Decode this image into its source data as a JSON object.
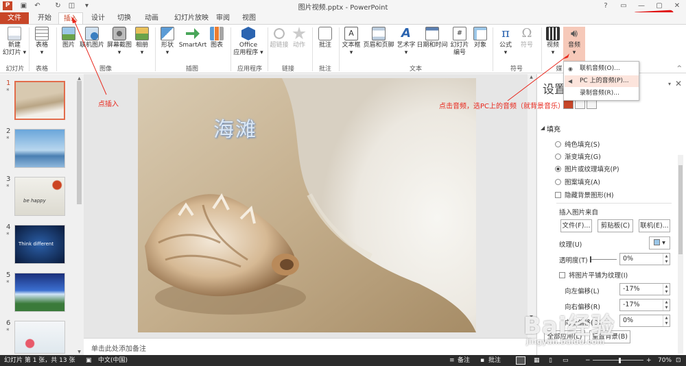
{
  "window": {
    "title": "图片视频.pptx - PowerPoint",
    "app_logo": "P",
    "controls": [
      "?",
      "▭",
      "—",
      "▢",
      "✕"
    ]
  },
  "qat": [
    "save-icon",
    "undo-icon",
    "redo-icon",
    "slideshow-icon",
    "customize-icon"
  ],
  "tabs": [
    {
      "label": "文件"
    },
    {
      "label": "开始"
    },
    {
      "label": "插入"
    },
    {
      "label": "设计"
    },
    {
      "label": "切换"
    },
    {
      "label": "动画"
    },
    {
      "label": "幻灯片放映"
    },
    {
      "label": "审阅"
    },
    {
      "label": "视图"
    }
  ],
  "ribbon": {
    "buttons": [
      {
        "label": "新建\n幻灯片 ▾"
      },
      {
        "label": "表格\n▾"
      },
      {
        "label": "图片"
      },
      {
        "label": "联机图片"
      },
      {
        "label": "屏幕截图\n▾"
      },
      {
        "label": "相册\n▾"
      },
      {
        "label": "形状\n▾"
      },
      {
        "label": "SmartArt"
      },
      {
        "label": "图表"
      },
      {
        "label": "Office\n应用程序 ▾"
      },
      {
        "label": "超链接"
      },
      {
        "label": "动作"
      },
      {
        "label": "批注"
      },
      {
        "label": "文本框\n▾"
      },
      {
        "label": "页眉和页脚"
      },
      {
        "label": "艺术字\n▾"
      },
      {
        "label": "日期和时间"
      },
      {
        "label": "幻灯片\n编号"
      },
      {
        "label": "对象"
      },
      {
        "label": "公式\n▾"
      },
      {
        "label": "符号"
      },
      {
        "label": "视频\n▾"
      },
      {
        "label": "音频\n▾"
      }
    ],
    "groups": [
      {
        "label": "幻灯片"
      },
      {
        "label": "表格"
      },
      {
        "label": "图像"
      },
      {
        "label": "插图"
      },
      {
        "label": "应用程序"
      },
      {
        "label": "链接"
      },
      {
        "label": "批注"
      },
      {
        "label": "文本"
      },
      {
        "label": "符号"
      },
      {
        "label": "媒"
      }
    ],
    "collapse_glyph": "^"
  },
  "audio_menu": {
    "items": [
      {
        "label": "联机音频(O)..."
      },
      {
        "label": "PC 上的音频(P)..."
      },
      {
        "label": "录制音频(R)..."
      }
    ]
  },
  "slides": [
    {
      "number": "1",
      "star": "*"
    },
    {
      "number": "2",
      "star": "*"
    },
    {
      "number": "3",
      "star": "*"
    },
    {
      "number": "4",
      "star": "*"
    },
    {
      "number": "5",
      "star": "*"
    },
    {
      "number": "6",
      "star": "*"
    }
  ],
  "thumb_texts": {
    "t3": "be happy",
    "t4": "Think different"
  },
  "slide": {
    "title": "海滩"
  },
  "notes_placeholder": "单击此处添加备注",
  "pane": {
    "title": "设置",
    "close": "✕",
    "options_glyph": "▾",
    "fill_section": "填充",
    "fill_options": [
      {
        "label": "纯色填充(S)"
      },
      {
        "label": "渐变填充(G)"
      },
      {
        "label": "图片或纹理填充(P)"
      },
      {
        "label": "图案填充(A)"
      }
    ],
    "hide_bg_label": "隐藏背景图形(H)",
    "insert_from_label": "插入图片来自",
    "file_btn": "文件(F)...",
    "clipboard_btn": "剪贴板(C)",
    "online_btn": "联机(E)...",
    "texture_label": "纹理(U)",
    "transparency_label": "透明度(T)",
    "transparency_value": "0%",
    "tile_label": "将图片平铺为纹理(I)",
    "offset_left_label": "向左偏移(L)",
    "offset_left_value": "-17%",
    "offset_right_label": "向右偏移(R)",
    "offset_right_value": "-17%",
    "offset_up_label": "向上偏移(O)",
    "offset_up_value": "0%",
    "apply_all_btn": "全部应用(L)",
    "reset_btn": "重置背景(B)"
  },
  "status": {
    "slide_info": "幻灯片 第 1 张，共 13 张",
    "language": "中文(中国)",
    "notes": "备注",
    "comments": "批注",
    "zoom": "70%"
  },
  "annotations": {
    "insert_hint": "点插入",
    "audio_hint": "点击音频，选PC上的音频（就背景音乐）"
  },
  "watermark": {
    "logo": "Bai经验",
    "url": "jingyan.baidu.com"
  },
  "colors": {
    "brand": "#c84628",
    "annotation": "#e8271c",
    "highlight": "#fce4dc"
  }
}
